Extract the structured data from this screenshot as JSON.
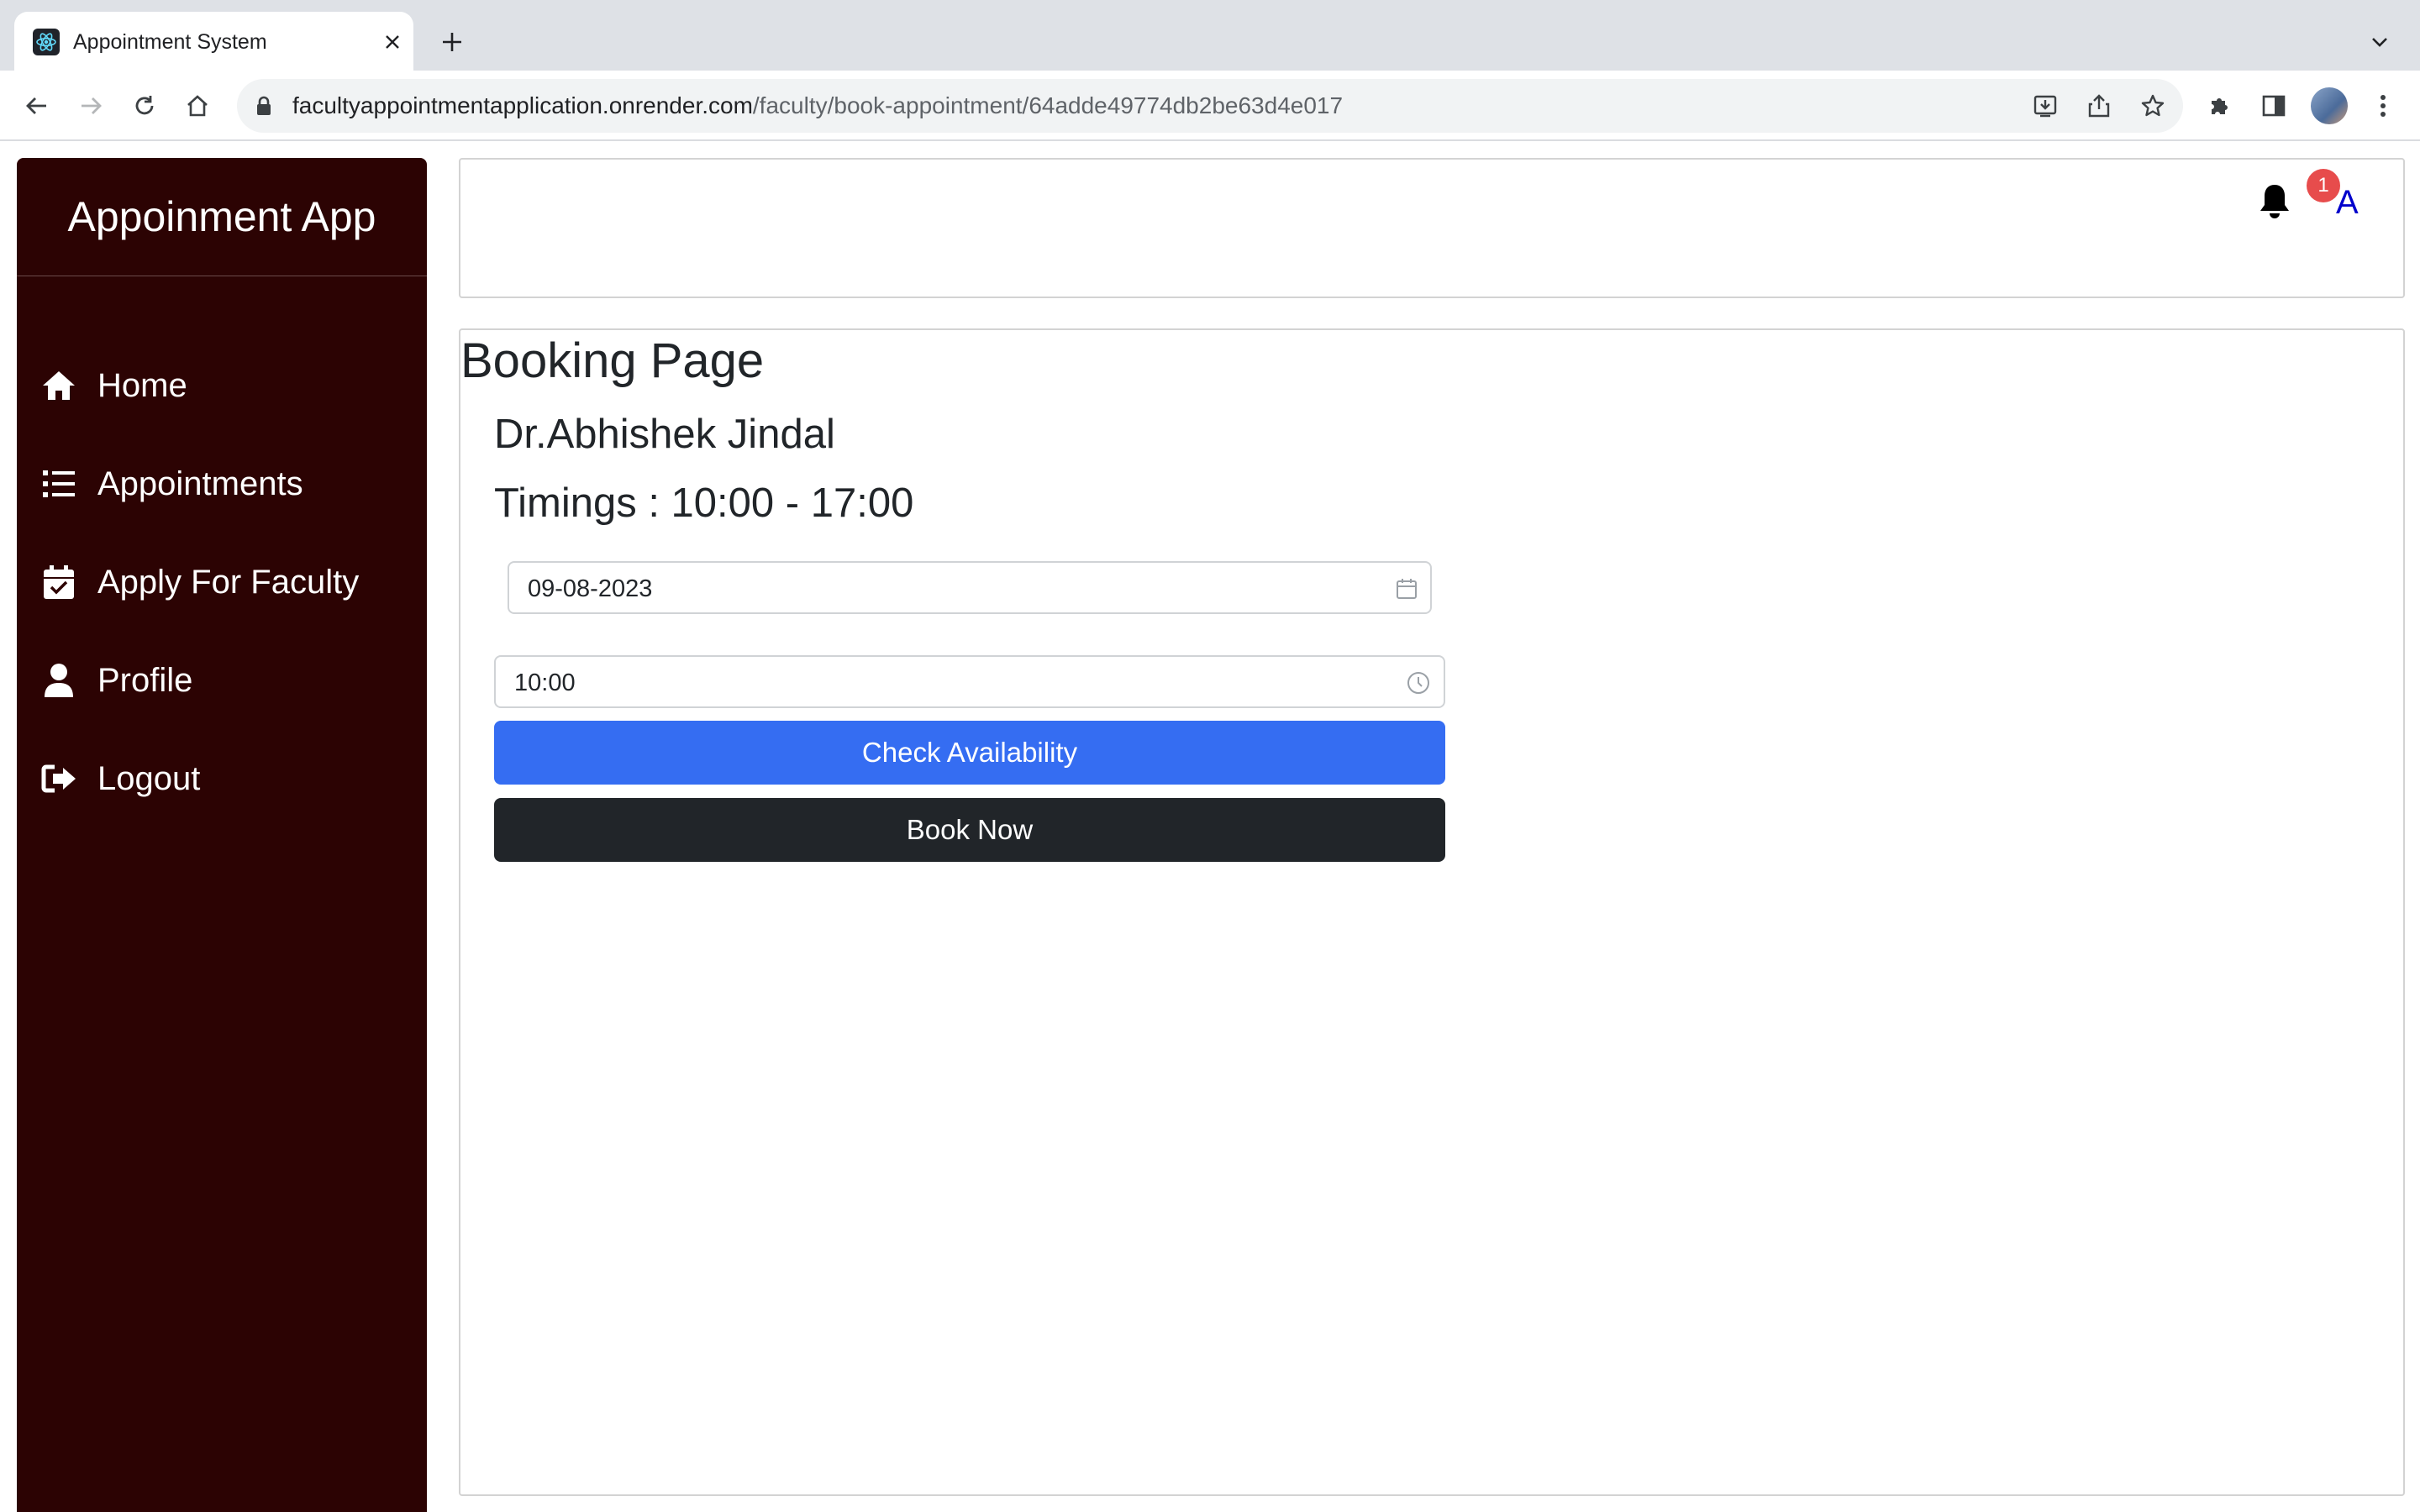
{
  "browser": {
    "tab_title": "Appointment System",
    "url_host": "facultyappointmentapplication.onrender.com",
    "url_path": "/faculty/book-appointment/64adde49774db2be63d4e017"
  },
  "sidebar": {
    "brand": "Appoinment App",
    "items": [
      {
        "label": "Home",
        "icon": "home-icon"
      },
      {
        "label": "Appointments",
        "icon": "list-icon"
      },
      {
        "label": "Apply For Faculty",
        "icon": "calendar-check-icon"
      },
      {
        "label": "Profile",
        "icon": "user-icon"
      },
      {
        "label": "Logout",
        "icon": "logout-icon"
      }
    ]
  },
  "header": {
    "notification_count": "1",
    "user_initial": "A"
  },
  "booking": {
    "page_title": "Booking Page",
    "doctor_name": "Dr.Abhishek Jindal",
    "timings": "Timings : 10:00 - 17:00",
    "date_value": "09-08-2023",
    "time_value": "10:00",
    "check_label": "Check Availability",
    "book_label": "Book Now"
  },
  "colors": {
    "sidebar_bg": "#2c0303",
    "primary_button": "#356df2",
    "dark_button": "#212529",
    "badge": "#e74c4c",
    "user_initial": "#0000cc"
  }
}
